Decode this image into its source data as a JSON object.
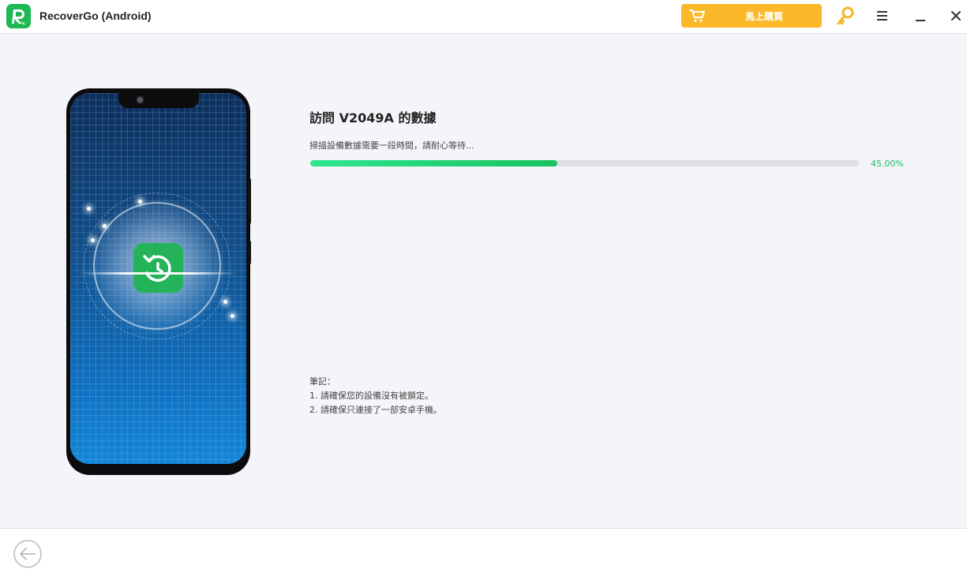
{
  "app": {
    "title": "RecoverGo (Android)"
  },
  "toolbar": {
    "buy_label": "馬上購買",
    "buy_color": "#fbb92a",
    "icons": [
      "cart-icon",
      "key-icon",
      "menu-icon",
      "minimize-icon",
      "close-icon"
    ]
  },
  "main": {
    "title": "訪問 V2049A 的數據",
    "status": "掃描設備數據需要一段時間，請耐心等待...",
    "progress": {
      "fraction": 0.45,
      "label": "45.00%",
      "color": "#1fbf60"
    },
    "notes": {
      "heading": "筆記：",
      "items": [
        "1. 請確保您的設備沒有被鎖定。",
        "2. 請確保只連接了一部安卓手機。"
      ]
    }
  },
  "footer": {
    "back_icon": "back-arrow-icon"
  }
}
